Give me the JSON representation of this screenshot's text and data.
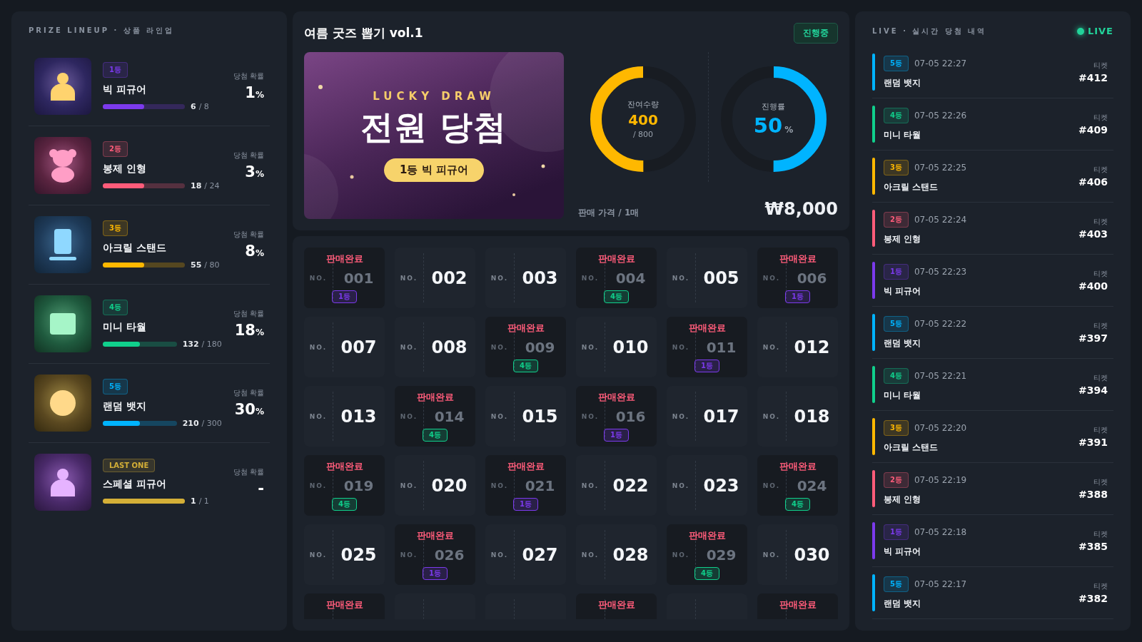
{
  "prize_panel": {
    "title": "PRIZE LINEUP · 상품 라인업",
    "prizes": [
      {
        "kind": "figure",
        "tier": "1등",
        "color": "#7c3aed",
        "name": "빅 피규어",
        "count": "6",
        "total": "/ 8",
        "level": 0.5,
        "odds_label": "당첨 확률",
        "odds": "1",
        "unit": "%"
      },
      {
        "kind": "bear",
        "tier": "2등",
        "color": "#ff5c7a",
        "name": "봉제 인형",
        "count": "18",
        "total": "/ 24",
        "level": 0.5,
        "odds_label": "당첨 확률",
        "odds": "3",
        "unit": "%"
      },
      {
        "kind": "stand",
        "tier": "3등",
        "color": "#ffb800",
        "name": "아크릴 스탠드",
        "count": "55",
        "total": "/ 80",
        "level": 0.5,
        "odds_label": "당첨 확률",
        "odds": "8",
        "unit": "%"
      },
      {
        "kind": "tile",
        "tier": "4등",
        "color": "#10d08c",
        "name": "미니 타월",
        "count": "132",
        "total": "/ 180",
        "level": 0.5,
        "odds_label": "당첨 확률",
        "odds": "18",
        "unit": "%"
      },
      {
        "kind": "badge",
        "tier": "5등",
        "color": "#00b4ff",
        "name": "랜덤 뱃지",
        "count": "210",
        "total": "/ 300",
        "level": 0.5,
        "odds_label": "당첨 확률",
        "odds": "30",
        "unit": "%"
      },
      {
        "kind": "special",
        "tier": "LAST ONE",
        "color": "#d4af37",
        "name": "스페셜 피규어",
        "count": "1",
        "total": "/ 1",
        "level": 1,
        "odds_label": "당첨 확률",
        "odds": "-"
      }
    ]
  },
  "draw": {
    "title": "여름 굿즈 뽑기 vol.1",
    "status": "진행중",
    "banner": {
      "eyebrow": "LUCKY DRAW",
      "headline": "전원 당첨",
      "prize": "1등 빅 피규어"
    },
    "gauges": [
      {
        "kind": "remaining",
        "label": "잔여수량",
        "value": "400",
        "sub": "/ 800",
        "level": 0.5
      },
      {
        "kind": "progress",
        "label": "진행률",
        "value": "50",
        "unit": "%",
        "level": 0.5
      }
    ],
    "price_label": "판매 가격 / 1매",
    "price": "₩8,000"
  },
  "tickets": [
    {
      "no": "NO.",
      "number": "001",
      "sold": true,
      "sold_label": "판매완료",
      "tier": "1등",
      "color": "#7c3aed"
    },
    {
      "no": "NO.",
      "number": "002",
      "sold": false
    },
    {
      "no": "NO.",
      "number": "003",
      "sold": false
    },
    {
      "no": "NO.",
      "number": "004",
      "sold": true,
      "sold_label": "판매완료",
      "tier": "4등",
      "color": "#10d08c"
    },
    {
      "no": "NO.",
      "number": "005",
      "sold": false
    },
    {
      "no": "NO.",
      "number": "006",
      "sold": true,
      "sold_label": "판매완료",
      "tier": "1등",
      "color": "#7c3aed"
    },
    {
      "no": "NO.",
      "number": "007",
      "sold": false
    },
    {
      "no": "NO.",
      "number": "008",
      "sold": false
    },
    {
      "no": "NO.",
      "number": "009",
      "sold": true,
      "sold_label": "판매완료",
      "tier": "4등",
      "color": "#10d08c"
    },
    {
      "no": "NO.",
      "number": "010",
      "sold": false
    },
    {
      "no": "NO.",
      "number": "011",
      "sold": true,
      "sold_label": "판매완료",
      "tier": "1등",
      "color": "#7c3aed"
    },
    {
      "no": "NO.",
      "number": "012",
      "sold": false
    },
    {
      "no": "NO.",
      "number": "013",
      "sold": false
    },
    {
      "no": "NO.",
      "number": "014",
      "sold": true,
      "sold_label": "판매완료",
      "tier": "4등",
      "color": "#10d08c"
    },
    {
      "no": "NO.",
      "number": "015",
      "sold": false
    },
    {
      "no": "NO.",
      "number": "016",
      "sold": true,
      "sold_label": "판매완료",
      "tier": "1등",
      "color": "#7c3aed"
    },
    {
      "no": "NO.",
      "number": "017",
      "sold": false
    },
    {
      "no": "NO.",
      "number": "018",
      "sold": false
    },
    {
      "no": "NO.",
      "number": "019",
      "sold": true,
      "sold_label": "판매완료",
      "tier": "4등",
      "color": "#10d08c"
    },
    {
      "no": "NO.",
      "number": "020",
      "sold": false
    },
    {
      "no": "NO.",
      "number": "021",
      "sold": true,
      "sold_label": "판매완료",
      "tier": "1등",
      "color": "#7c3aed"
    },
    {
      "no": "NO.",
      "number": "022",
      "sold": false
    },
    {
      "no": "NO.",
      "number": "023",
      "sold": false
    },
    {
      "no": "NO.",
      "number": "024",
      "sold": true,
      "sold_label": "판매완료",
      "tier": "4등",
      "color": "#10d08c"
    },
    {
      "no": "NO.",
      "number": "025",
      "sold": false
    },
    {
      "no": "NO.",
      "number": "026",
      "sold": true,
      "sold_label": "판매완료",
      "tier": "1등",
      "color": "#7c3aed"
    },
    {
      "no": "NO.",
      "number": "027",
      "sold": false
    },
    {
      "no": "NO.",
      "number": "028",
      "sold": false
    },
    {
      "no": "NO.",
      "number": "029",
      "sold": true,
      "sold_label": "판매완료",
      "tier": "4등",
      "color": "#10d08c"
    },
    {
      "no": "NO.",
      "number": "030",
      "sold": false
    },
    {
      "sold": true,
      "sold_label": "판매완료"
    },
    {
      "sold": false
    },
    {
      "sold": false
    },
    {
      "sold": true,
      "sold_label": "판매완료"
    },
    {
      "sold": false
    },
    {
      "sold": true,
      "sold_label": "판매완료"
    }
  ],
  "live": {
    "title": "LIVE · 실시간 당첨 내역",
    "badge": "LIVE",
    "wins": [
      {
        "tier": "5등",
        "color": "#00b4ff",
        "time": "07-05 22:27",
        "prize": "랜덤 뱃지",
        "ticket_label": "티켓",
        "ticket": "#412"
      },
      {
        "tier": "4등",
        "color": "#10d08c",
        "time": "07-05 22:26",
        "prize": "미니 타월",
        "ticket_label": "티켓",
        "ticket": "#409"
      },
      {
        "tier": "3등",
        "color": "#ffb800",
        "time": "07-05 22:25",
        "prize": "아크릴 스탠드",
        "ticket_label": "티켓",
        "ticket": "#406"
      },
      {
        "tier": "2등",
        "color": "#ff5c7a",
        "time": "07-05 22:24",
        "prize": "봉제 인형",
        "ticket_label": "티켓",
        "ticket": "#403"
      },
      {
        "tier": "1등",
        "color": "#7c3aed",
        "time": "07-05 22:23",
        "prize": "빅 피규어",
        "ticket_label": "티켓",
        "ticket": "#400"
      },
      {
        "tier": "5등",
        "color": "#00b4ff",
        "time": "07-05 22:22",
        "prize": "랜덤 뱃지",
        "ticket_label": "티켓",
        "ticket": "#397"
      },
      {
        "tier": "4등",
        "color": "#10d08c",
        "time": "07-05 22:21",
        "prize": "미니 타월",
        "ticket_label": "티켓",
        "ticket": "#394"
      },
      {
        "tier": "3등",
        "color": "#ffb800",
        "time": "07-05 22:20",
        "prize": "아크릴 스탠드",
        "ticket_label": "티켓",
        "ticket": "#391"
      },
      {
        "tier": "2등",
        "color": "#ff5c7a",
        "time": "07-05 22:19",
        "prize": "봉제 인형",
        "ticket_label": "티켓",
        "ticket": "#388"
      },
      {
        "tier": "1등",
        "color": "#7c3aed",
        "time": "07-05 22:18",
        "prize": "빅 피규어",
        "ticket_label": "티켓",
        "ticket": "#385"
      },
      {
        "tier": "5등",
        "color": "#00b4ff",
        "time": "07-05 22:17",
        "prize": "랜덤 뱃지",
        "ticket_label": "티켓",
        "ticket": "#382"
      }
    ]
  }
}
